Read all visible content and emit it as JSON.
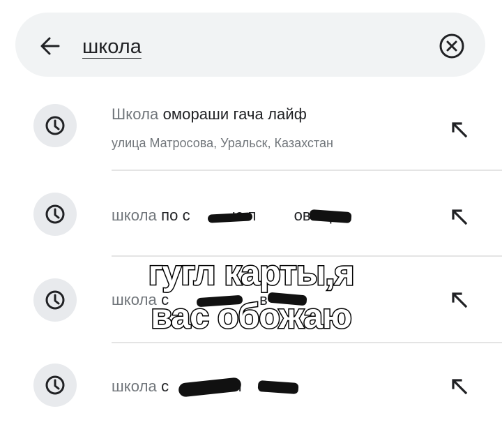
{
  "search": {
    "query": "школа",
    "back_icon": "arrow-left-icon",
    "clear_icon": "clear-circle-icon"
  },
  "suggestions": [
    {
      "prefix": "Школа",
      "rest": " омораши гача лайф",
      "subtitle": "улица Матросова, Уральск, Казахстан",
      "icon": "history-clock-icon"
    },
    {
      "prefix": "школа",
      "rest": " по с",
      "rest2": "ю п",
      "rest3": "ов гар...",
      "icon": "history-clock-icon"
    },
    {
      "prefix": "школа",
      "rest": " с",
      "rest2": "",
      "rest3": "в",
      "icon": "history-clock-icon"
    },
    {
      "prefix": "школа",
      "rest": " с",
      "rest2": "е п",
      "rest3": "с",
      "icon": "history-clock-icon"
    }
  ],
  "caption": {
    "line1": "гугл карты,я",
    "line2": "вас обожаю"
  },
  "colors": {
    "search_bg": "#f1f3f4",
    "icon_circle_bg": "#e8eaed",
    "secondary_text": "#70757a",
    "primary_text": "#202124"
  }
}
